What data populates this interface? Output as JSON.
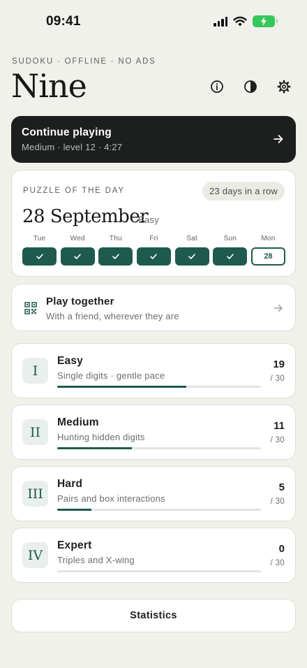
{
  "status_bar": {
    "time": "09:41"
  },
  "header": {
    "eyebrow": "SUDOKU · OFFLINE · NO ADS",
    "title": "Nine"
  },
  "continue": {
    "title": "Continue playing",
    "subtitle": "Medium · level 12 · 4:27"
  },
  "puzzle_of_the_day": {
    "label": "PUZZLE OF THE DAY",
    "streak": "23 days in a row",
    "date": "28 September",
    "difficulty": "Easy",
    "week": [
      {
        "day": "Tue",
        "done": true
      },
      {
        "day": "Wed",
        "done": true
      },
      {
        "day": "Thu",
        "done": true
      },
      {
        "day": "Fri",
        "done": true
      },
      {
        "day": "Sat",
        "done": true
      },
      {
        "day": "Sun",
        "done": true
      },
      {
        "day": "Mon",
        "done": false,
        "date": "28"
      }
    ]
  },
  "play_together": {
    "title": "Play together",
    "subtitle": "With a friend, wherever they are"
  },
  "levels": [
    {
      "numeral": "I",
      "title": "Easy",
      "subtitle": "Single digits · gentle pace",
      "solved": "19",
      "total": "/ 30",
      "progress": 0.633
    },
    {
      "numeral": "II",
      "title": "Medium",
      "subtitle": "Hunting hidden digits",
      "solved": "11",
      "total": "/ 30",
      "progress": 0.367
    },
    {
      "numeral": "III",
      "title": "Hard",
      "subtitle": "Pairs and box interactions",
      "solved": "5",
      "total": "/ 30",
      "progress": 0.167
    },
    {
      "numeral": "IV",
      "title": "Expert",
      "subtitle": "Triples and X-wing",
      "solved": "0",
      "total": "/ 30",
      "progress": 0
    }
  ],
  "statistics": {
    "label": "Statistics"
  },
  "colors": {
    "accent": "#1f5a4e",
    "dark_card": "#1c1f1d",
    "background": "#f1f1ec"
  },
  "icons": {
    "header": [
      "info-icon",
      "contrast-icon",
      "gear-icon"
    ],
    "status": [
      "cellular-signal-icon",
      "wifi-icon",
      "battery-charging-icon"
    ]
  }
}
